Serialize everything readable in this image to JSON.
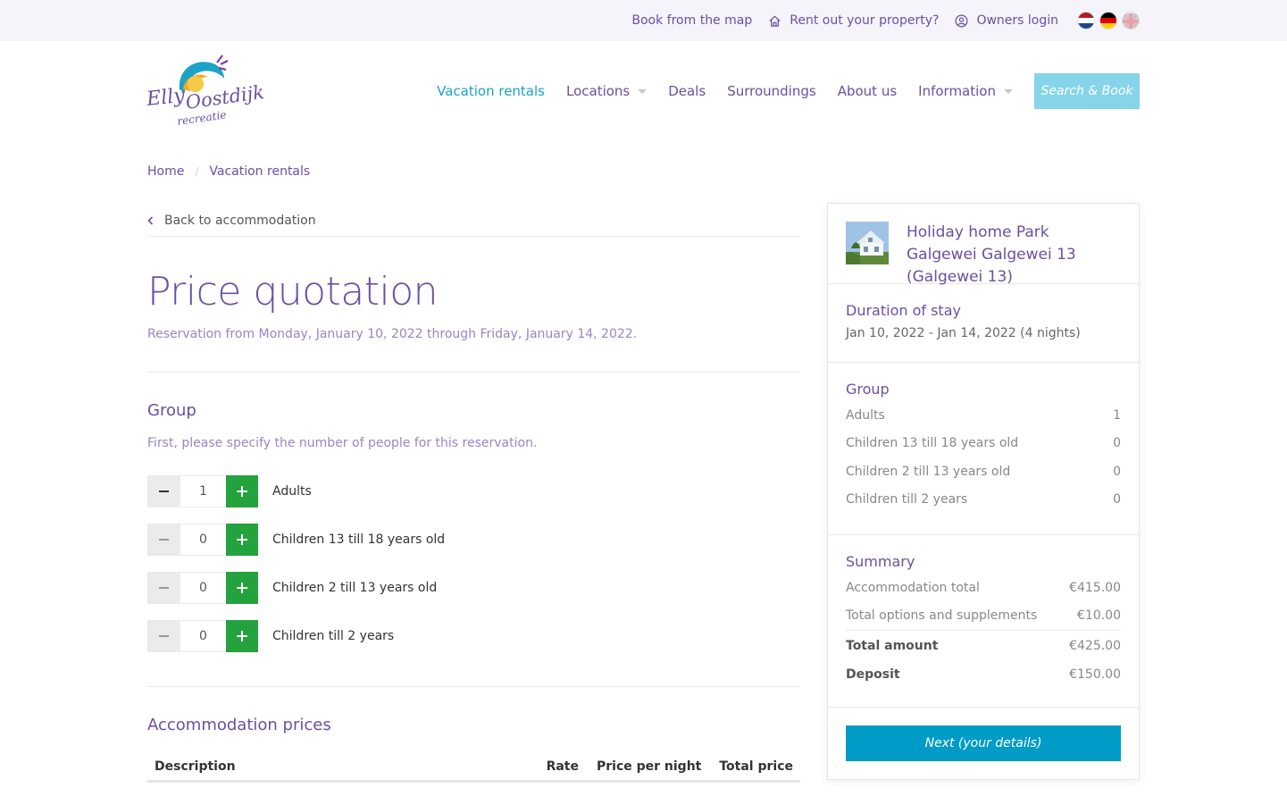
{
  "topbar": {
    "book_map": "Book from the map",
    "rent_out": "Rent out your property?",
    "owners_login": "Owners login"
  },
  "brand": {
    "logo_text": "Elly Oostdijk",
    "logo_sub": "recreatie"
  },
  "nav": {
    "items": [
      {
        "label": "Vacation rentals",
        "active": true
      },
      {
        "label": "Locations",
        "dropdown": true
      },
      {
        "label": "Deals"
      },
      {
        "label": "Surroundings"
      },
      {
        "label": "About us"
      },
      {
        "label": "Information",
        "dropdown": true
      }
    ],
    "search_book": "Search & Book"
  },
  "breadcrumb": [
    "Home",
    "Vacation rentals"
  ],
  "main": {
    "back_label": "Back to accommodation",
    "title": "Price quotation",
    "reservation": "Reservation from Monday, January 10, 2022 through Friday, January 14, 2022.",
    "group_title": "Group",
    "group_helper": "First, please specify the number of people for this reservation.",
    "steppers": [
      {
        "label": "Adults",
        "value": "1"
      },
      {
        "label": "Children 13 till 18 years old",
        "value": "0"
      },
      {
        "label": "Children 2 till 13 years old",
        "value": "0"
      },
      {
        "label": "Children till 2 years",
        "value": "0"
      }
    ],
    "prices_title": "Accommodation prices",
    "table_headers": [
      "Description",
      "Rate",
      "Price per night",
      "Total price"
    ]
  },
  "sidebar": {
    "property_name": "Holiday home Park Galgewei Galgewei 13 (Galgewei 13)",
    "duration_title": "Duration of stay",
    "duration_text": "Jan 10, 2022 - Jan 14, 2022 (4 nights)",
    "group_title": "Group",
    "group_rows": [
      {
        "label": "Adults",
        "value": "1"
      },
      {
        "label": "Children 13 till 18 years old",
        "value": "0"
      },
      {
        "label": "Children 2 till 13 years old",
        "value": "0"
      },
      {
        "label": "Children till 2 years",
        "value": "0"
      }
    ],
    "summary_title": "Summary",
    "summary_rows": [
      {
        "label": "Accommodation total",
        "value": "€415.00"
      },
      {
        "label": "Total options and supplements",
        "value": "€10.00"
      }
    ],
    "total_label": "Total amount",
    "total_value": "€425.00",
    "deposit_label": "Deposit",
    "deposit_value": "€150.00",
    "next_button": "Next (your details)"
  },
  "colors": {
    "brand_purple": "#6b4fa3",
    "accent_cyan": "#1ca3c5",
    "plus_green": "#23a23d",
    "cta_blue": "#009bc7"
  }
}
